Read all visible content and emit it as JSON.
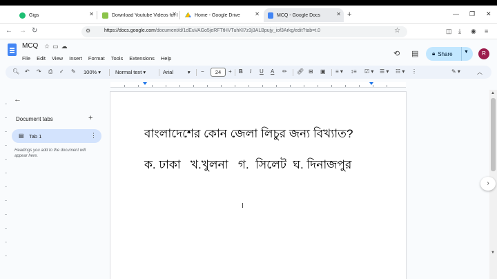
{
  "browser": {
    "tabs": [
      {
        "title": "Gigs",
        "fav_color": "#1dbf73"
      },
      {
        "title": "Download Youtube Videos for F",
        "fav_color": "#8bc34a"
      },
      {
        "title": "Home - Google Drive",
        "fav_color": "#fbbc04"
      },
      {
        "title": "MCQ - Google Docs",
        "fav_color": "#4285f4"
      }
    ],
    "url_host": "https://docs.google.com",
    "url_path": "/document/d/1dEuVAGo5jeRFTtHVTuhKI7z3j3ALBpujy_iof3Arkg/edit?tab=t.0"
  },
  "docs": {
    "title": "MCQ",
    "menu": [
      "File",
      "Edit",
      "View",
      "Insert",
      "Format",
      "Tools",
      "Extensions",
      "Help"
    ],
    "share_label": "Share",
    "avatar_letter": "R",
    "toolbar": {
      "zoom": "100%",
      "style": "Normal text",
      "font": "Arial",
      "font_size": "24"
    },
    "sidebar": {
      "heading": "Document tabs",
      "tab_label": "Tab 1",
      "hint": "Headings you add to the document will appear here."
    },
    "content": {
      "line1": "বাংলাদেশের কোন জেলা লিচুর জন্য বিখ্যাত?",
      "line2": "ক. ঢাকা   খ.খুলনা   গ.  সিলেট  ঘ. দিনাজপুর"
    }
  }
}
